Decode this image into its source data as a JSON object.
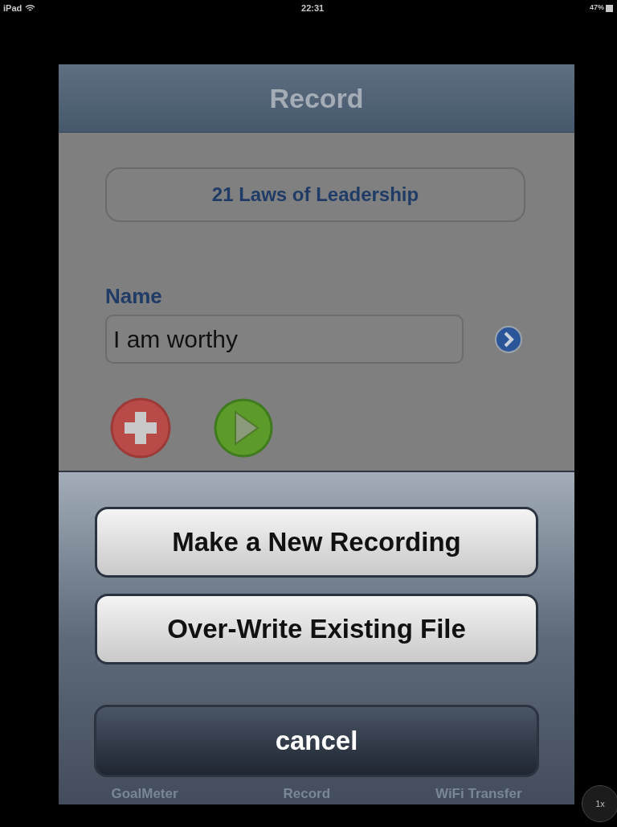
{
  "status_bar": {
    "device": "iPad",
    "time": "22:31",
    "battery": "47%"
  },
  "nav_bar": {
    "title": "Record"
  },
  "book_button": {
    "label": "21 Laws of Leadership"
  },
  "name_field": {
    "label": "Name",
    "value": "I am worthy"
  },
  "action_sheet": {
    "buttons": [
      {
        "label": "Make a New Recording",
        "kind": "default"
      },
      {
        "label": "Over-Write Existing File",
        "kind": "default"
      },
      {
        "label": "cancel",
        "kind": "cancel"
      }
    ]
  },
  "tab_bar": {
    "items": [
      {
        "label": "GoalMeter"
      },
      {
        "label": "Record"
      },
      {
        "label": "WiFi Transfer"
      }
    ]
  },
  "zoom_button": {
    "label": "1x"
  }
}
